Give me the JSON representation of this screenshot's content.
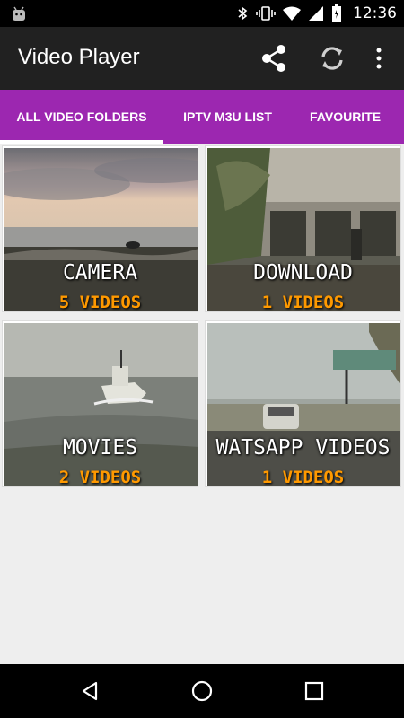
{
  "status_bar": {
    "time": "12:36",
    "icons": [
      "android-icon",
      "bluetooth-icon",
      "vibrate-icon",
      "wifi-icon",
      "signal-icon",
      "battery-icon"
    ]
  },
  "toolbar": {
    "title": "Video Player",
    "actions": [
      "share-icon",
      "refresh-icon",
      "more-vert-icon"
    ]
  },
  "tabs": [
    {
      "label": "ALL VIDEO FOLDERS",
      "active": true
    },
    {
      "label": "IPTV M3U LIST",
      "active": false
    },
    {
      "label": "FAVOURITE",
      "active": false
    }
  ],
  "folders": [
    {
      "name": "CAMERA",
      "count": "5 VIDEOS"
    },
    {
      "name": "DOWNLOAD",
      "count": "1 VIDEOS"
    },
    {
      "name": "MOVIES",
      "count": "2 VIDEOS"
    },
    {
      "name": "WATSAPP VIDEOS",
      "count": "1 VIDEOS"
    }
  ],
  "colors": {
    "tab_bar": "#9c27b0",
    "toolbar": "#212121",
    "count_text": "#ff9900",
    "background": "#eeeeee"
  },
  "nav_bar": [
    "back-icon",
    "home-icon",
    "recents-icon"
  ]
}
